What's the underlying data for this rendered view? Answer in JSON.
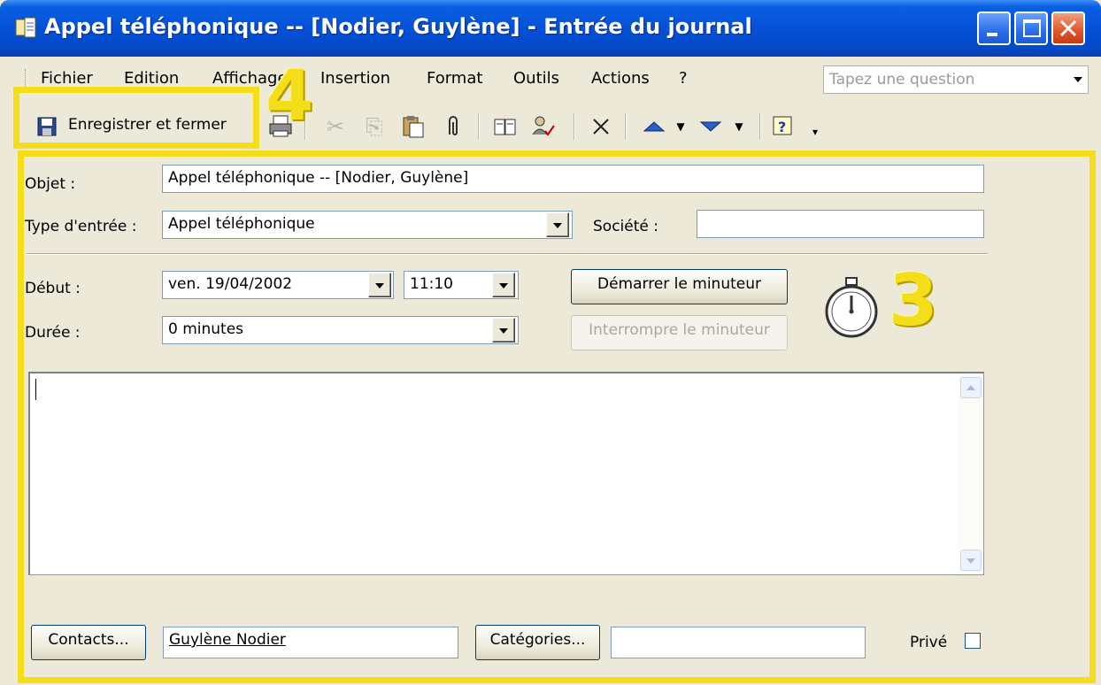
{
  "window": {
    "title": "Appel téléphonique -- [Nodier, Guylène] - Entrée du journal"
  },
  "menu": {
    "items": [
      "Fichier",
      "Edition",
      "Affichage",
      "Insertion",
      "Format",
      "Outils",
      "Actions",
      "?"
    ],
    "help_placeholder": "Tapez une question"
  },
  "toolbar": {
    "save_label": "Enregistrer et fermer"
  },
  "annotations": {
    "step_toolbar": "4",
    "step_form": "3",
    "highlight_color": "#f4de1a"
  },
  "form": {
    "subject_label": "Objet :",
    "subject_value": "Appel téléphonique -- [Nodier, Guylène]",
    "entry_type_label": "Type d'entrée :",
    "entry_type_value": "Appel téléphonique",
    "company_label": "Société :",
    "company_value": "",
    "start_label": "Début :",
    "start_date": "ven. 19/04/2002",
    "start_time": "11:10",
    "duration_label": "Durée :",
    "duration_value": "0 minutes",
    "start_timer_label": "Démarrer le minuteur",
    "stop_timer_label": "Interrompre le minuteur",
    "notes": "",
    "contacts_button": "Contacts...",
    "contacts_value": "Guylène Nodier",
    "categories_button": "Catégories...",
    "categories_value": "",
    "private_label": "Privé",
    "private_checked": false
  },
  "icons": [
    "journal-icon",
    "minimize-icon",
    "maximize-icon",
    "close-icon",
    "save-icon",
    "print-icon",
    "cut-icon",
    "copy-icon",
    "paste-icon",
    "attach-icon",
    "address-book-icon",
    "check-names-icon",
    "delete-icon",
    "previous-item-icon",
    "next-item-icon",
    "help-icon",
    "stopwatch-icon"
  ]
}
